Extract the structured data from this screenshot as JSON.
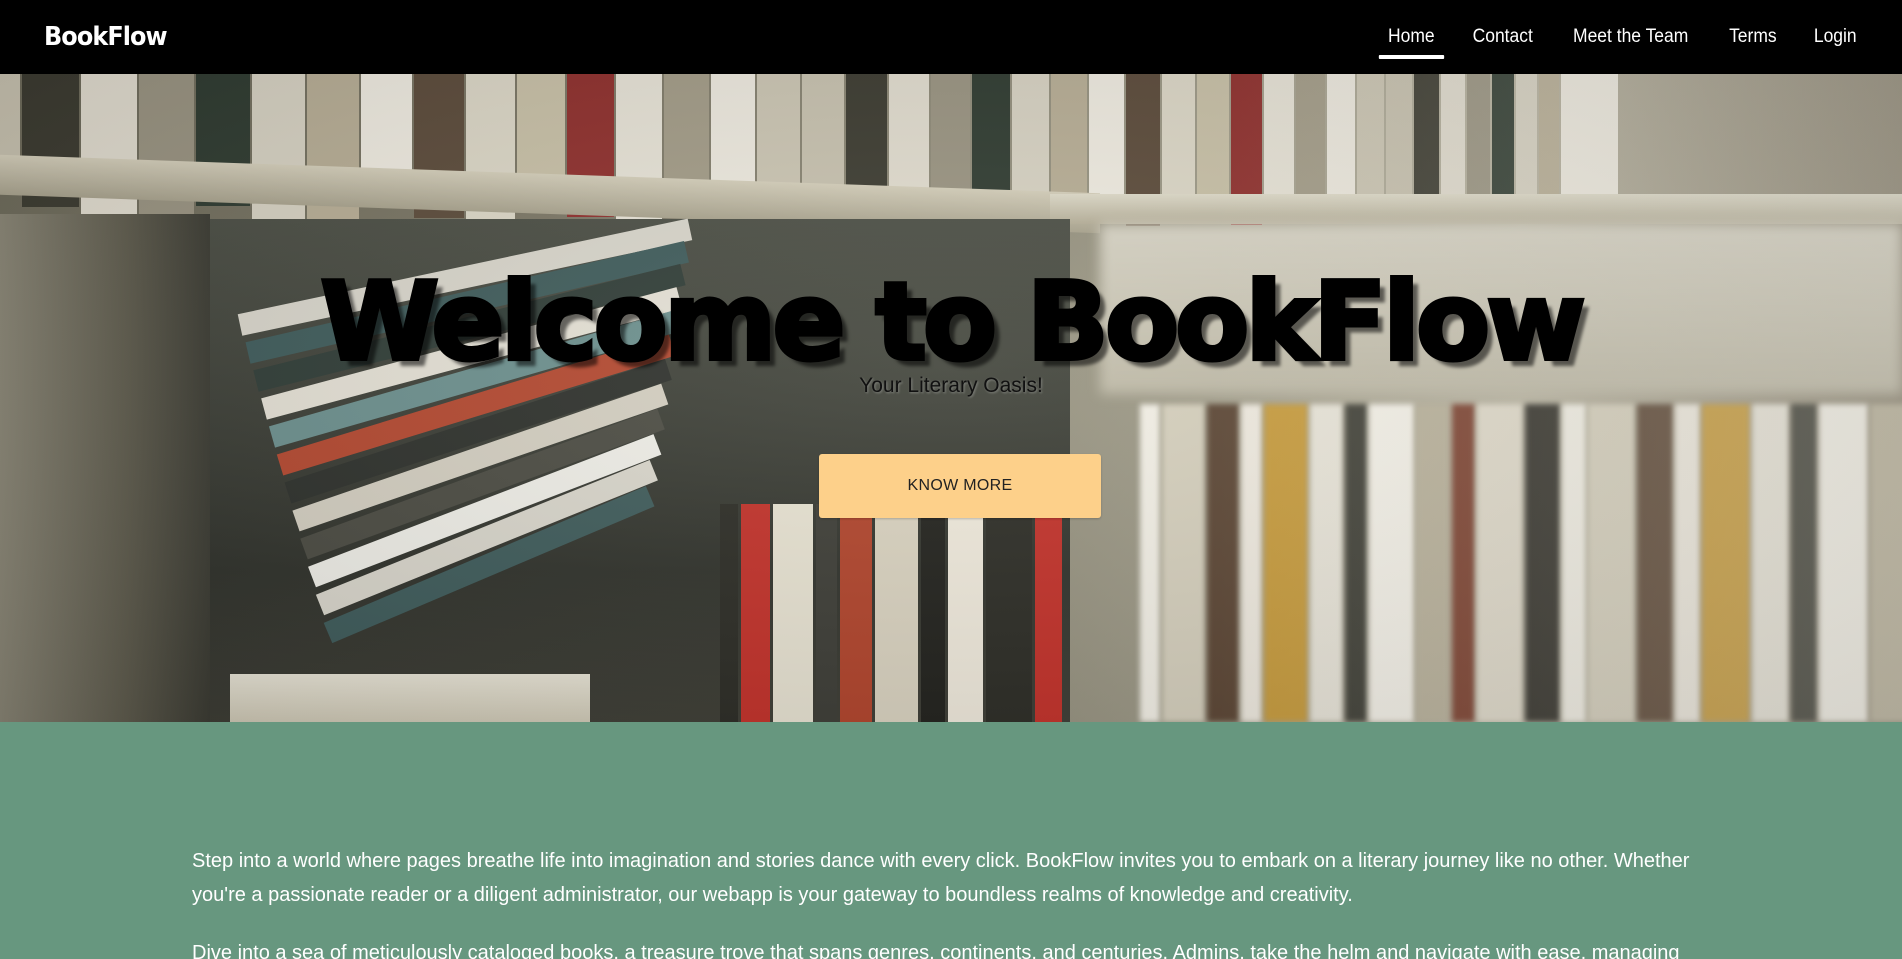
{
  "navbar": {
    "brand": "BookFlow",
    "links": [
      "Home",
      "Contact",
      "Meet the Team",
      "Terms",
      "Login"
    ],
    "active": "Home"
  },
  "hero": {
    "title": "Welcome to BookFlow",
    "subtitle": "Your Literary Oasis!",
    "button_label": "KNOW MORE"
  },
  "about": {
    "paragraphs": [
      "Step into a world where pages breathe life into imagination and stories dance with every click. BookFlow invites you to embark on a literary journey like no other. Whether you're a passionate reader or a diligent administrator, our webapp is your gateway to boundless realms of knowledge and creativity.",
      "Dive into a sea of meticulously cataloged books, a treasure trove that spans genres, continents, and centuries. Admins, take the helm and navigate with ease, managing your"
    ]
  },
  "colors": {
    "navbar_bg": "#000000",
    "button_bg": "#fdd08a",
    "about_bg": "#67977f"
  }
}
